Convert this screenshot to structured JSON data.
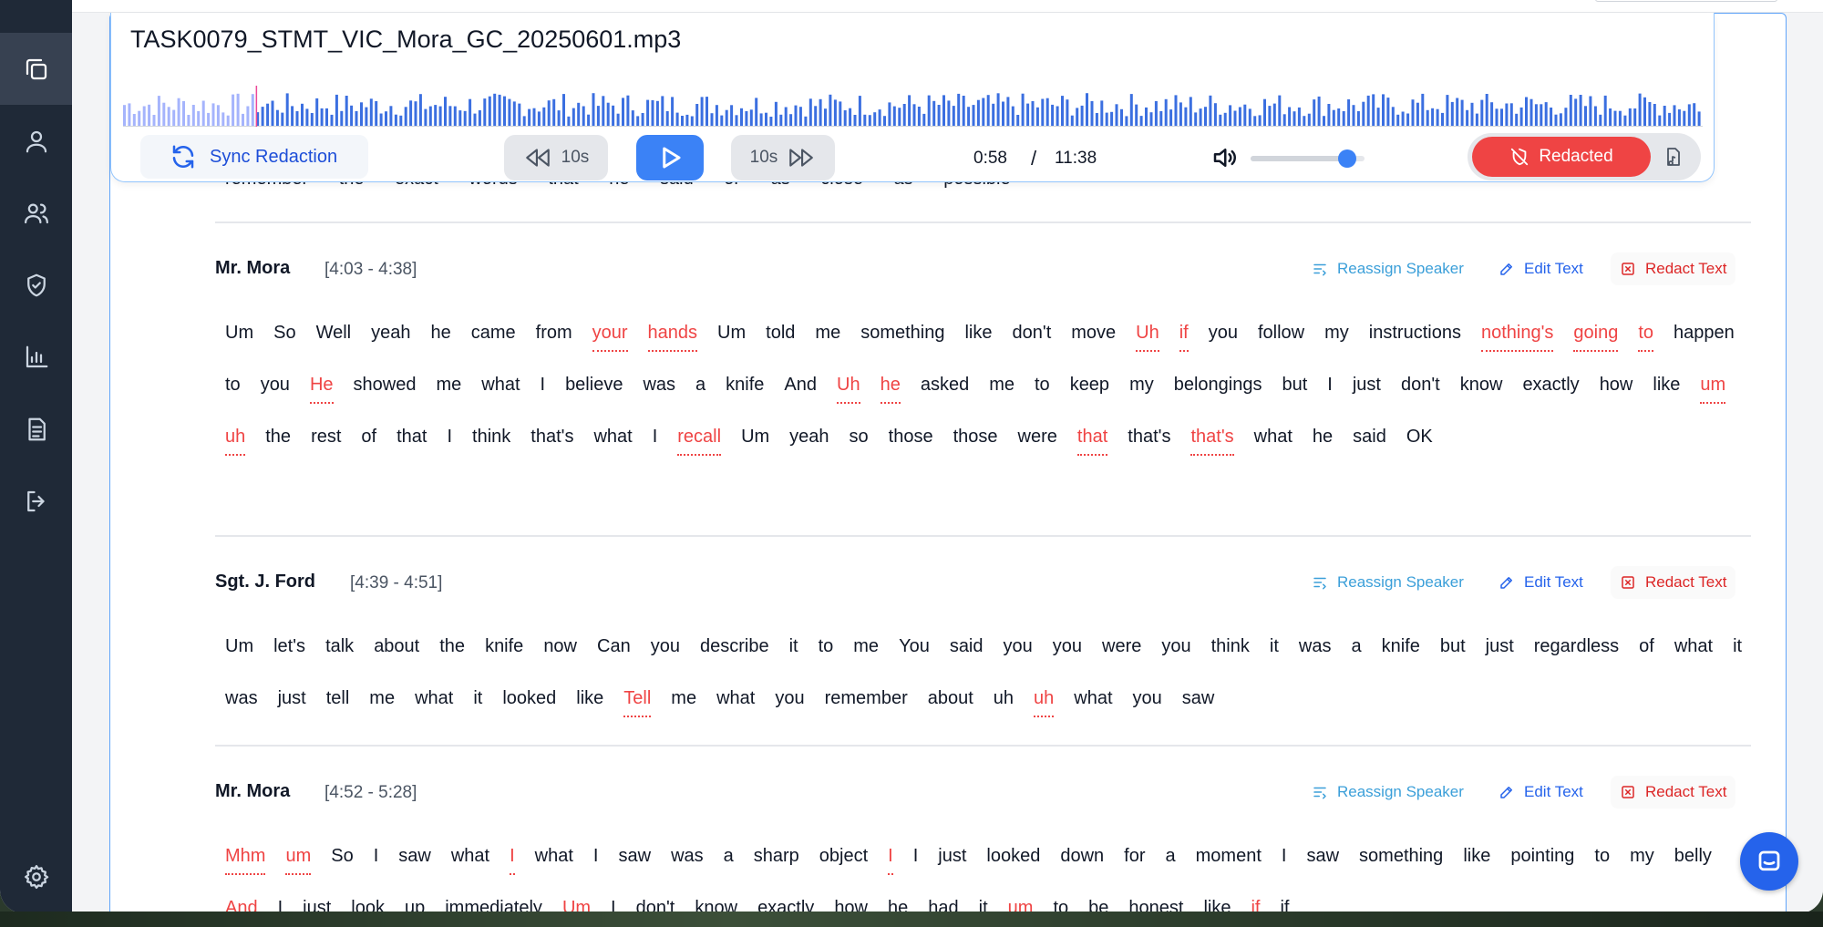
{
  "player": {
    "file_name": "TASK0079_STMT_VIC_Mora_GC_20250601.mp3",
    "sync_label": "Sync Redaction",
    "rewind_label": "10s",
    "forward_label": "10s",
    "current_time": "0:58",
    "time_separator": "/",
    "total_time": "11:38",
    "volume_percent": 85,
    "progress_percent": 8.4,
    "redacted_label": "Redacted"
  },
  "actions": {
    "reassign": "Reassign Speaker",
    "edit": "Edit Text",
    "redact": "Redact Text"
  },
  "partial_line": "remember the exact words that he said or as close as possible",
  "segments": [
    {
      "speaker": "Mr. Mora",
      "time": "[4:03 - 4:38]",
      "words": [
        [
          "Um",
          0
        ],
        [
          "So",
          0
        ],
        [
          "Well",
          0
        ],
        [
          "yeah",
          0
        ],
        [
          "he",
          0
        ],
        [
          "came",
          0
        ],
        [
          "from",
          0
        ],
        [
          "your",
          1
        ],
        [
          "hands",
          1
        ],
        [
          "Um",
          0
        ],
        [
          "told",
          0
        ],
        [
          "me",
          0
        ],
        [
          "something",
          0
        ],
        [
          "like",
          0
        ],
        [
          "don't",
          0
        ],
        [
          "move",
          0
        ],
        [
          "Uh",
          1
        ],
        [
          "if",
          1
        ],
        [
          "you",
          0
        ],
        [
          "follow",
          0
        ],
        [
          "my",
          0
        ],
        [
          "instructions",
          0
        ],
        [
          "nothing's",
          1
        ],
        [
          "going",
          1
        ],
        [
          "to",
          1
        ],
        [
          "happen",
          0
        ],
        [
          "to",
          0
        ],
        [
          "you",
          0
        ],
        [
          "He",
          1
        ],
        [
          "showed",
          0
        ],
        [
          "me",
          0
        ],
        [
          "what",
          0
        ],
        [
          "I",
          0
        ],
        [
          "believe",
          0
        ],
        [
          "was",
          0
        ],
        [
          "a",
          0
        ],
        [
          "knife",
          0
        ],
        [
          "And",
          0
        ],
        [
          "Uh",
          1
        ],
        [
          "he",
          1
        ],
        [
          "asked",
          0
        ],
        [
          "me",
          0
        ],
        [
          "to",
          0
        ],
        [
          "keep",
          0
        ],
        [
          "my",
          0
        ],
        [
          "belongings",
          0
        ],
        [
          "but",
          0
        ],
        [
          "I",
          0
        ],
        [
          "just",
          0
        ],
        [
          "don't",
          0
        ],
        [
          "know",
          0
        ],
        [
          "exactly",
          0
        ],
        [
          "how",
          0
        ],
        [
          "like",
          0
        ],
        [
          "um",
          1
        ],
        [
          "uh",
          1
        ],
        [
          "the",
          0
        ],
        [
          "rest",
          0
        ],
        [
          "of",
          0
        ],
        [
          "that",
          0
        ],
        [
          "I",
          0
        ],
        [
          "think",
          0
        ],
        [
          "that's",
          0
        ],
        [
          "what",
          0
        ],
        [
          "I",
          0
        ],
        [
          "recall",
          1
        ],
        [
          "Um",
          0
        ],
        [
          "yeah",
          0
        ],
        [
          "so",
          0
        ],
        [
          "those",
          0
        ],
        [
          "those",
          0
        ],
        [
          "were",
          0
        ],
        [
          "that",
          1
        ],
        [
          "that's",
          0
        ],
        [
          "that's",
          1
        ],
        [
          "what",
          0
        ],
        [
          "he",
          0
        ],
        [
          "said",
          0
        ],
        [
          "OK",
          0
        ]
      ]
    },
    {
      "speaker": "Sgt. J. Ford",
      "time": "[4:39 - 4:51]",
      "words": [
        [
          "Um",
          0
        ],
        [
          "let's",
          0
        ],
        [
          "talk",
          0
        ],
        [
          "about",
          0
        ],
        [
          "the",
          0
        ],
        [
          "knife",
          0
        ],
        [
          "now",
          0
        ],
        [
          "Can",
          0
        ],
        [
          "you",
          0
        ],
        [
          "describe",
          0
        ],
        [
          "it",
          0
        ],
        [
          "to",
          0
        ],
        [
          "me",
          0
        ],
        [
          "You",
          0
        ],
        [
          "said",
          0
        ],
        [
          "you",
          0
        ],
        [
          "you",
          0
        ],
        [
          "were",
          0
        ],
        [
          "you",
          0
        ],
        [
          "think",
          0
        ],
        [
          "it",
          0
        ],
        [
          "was",
          0
        ],
        [
          "a",
          0
        ],
        [
          "knife",
          0
        ],
        [
          "but",
          0
        ],
        [
          "just",
          0
        ],
        [
          "regardless",
          0
        ],
        [
          "of",
          0
        ],
        [
          "what",
          0
        ],
        [
          "it",
          0
        ],
        [
          "was",
          0
        ],
        [
          "just",
          0
        ],
        [
          "tell",
          0
        ],
        [
          "me",
          0
        ],
        [
          "what",
          0
        ],
        [
          "it",
          0
        ],
        [
          "looked",
          0
        ],
        [
          "like",
          0
        ],
        [
          "Tell",
          1
        ],
        [
          "me",
          0
        ],
        [
          "what",
          0
        ],
        [
          "you",
          0
        ],
        [
          "remember",
          0
        ],
        [
          "about",
          0
        ],
        [
          "uh",
          0
        ],
        [
          "uh",
          1
        ],
        [
          "what",
          0
        ],
        [
          "you",
          0
        ],
        [
          "saw",
          0
        ]
      ]
    },
    {
      "speaker": "Mr. Mora",
      "time": "[4:52 - 5:28]",
      "words": [
        [
          "Mhm",
          1
        ],
        [
          "um",
          1
        ],
        [
          "So",
          0
        ],
        [
          "I",
          0
        ],
        [
          "saw",
          0
        ],
        [
          "what",
          0
        ],
        [
          "I",
          1
        ],
        [
          "what",
          0
        ],
        [
          "I",
          0
        ],
        [
          "saw",
          0
        ],
        [
          "was",
          0
        ],
        [
          "a",
          0
        ],
        [
          "sharp",
          0
        ],
        [
          "object",
          0
        ],
        [
          "I",
          1
        ],
        [
          "I",
          0
        ],
        [
          "just",
          0
        ],
        [
          "looked",
          0
        ],
        [
          "down",
          0
        ],
        [
          "for",
          0
        ],
        [
          "a",
          0
        ],
        [
          "moment",
          0
        ],
        [
          "I",
          0
        ],
        [
          "saw",
          0
        ],
        [
          "something",
          0
        ],
        [
          "like",
          0
        ],
        [
          "pointing",
          0
        ],
        [
          "to",
          0
        ],
        [
          "my",
          0
        ],
        [
          "belly",
          0
        ],
        [
          "And",
          1
        ],
        [
          "I",
          0
        ],
        [
          "just",
          0
        ],
        [
          "look",
          0
        ],
        [
          "up",
          0
        ],
        [
          "immediately",
          0
        ],
        [
          "Um",
          1
        ],
        [
          "I",
          0
        ],
        [
          "don't",
          0
        ],
        [
          "know",
          0
        ],
        [
          "exactly",
          0
        ],
        [
          "how",
          0
        ],
        [
          "he",
          0
        ],
        [
          "had",
          0
        ],
        [
          "it",
          0
        ],
        [
          "um",
          1
        ],
        [
          "to",
          0
        ],
        [
          "be",
          0
        ],
        [
          "honest",
          0
        ],
        [
          "like",
          0
        ],
        [
          "if",
          1
        ],
        [
          "if",
          0
        ]
      ]
    }
  ]
}
